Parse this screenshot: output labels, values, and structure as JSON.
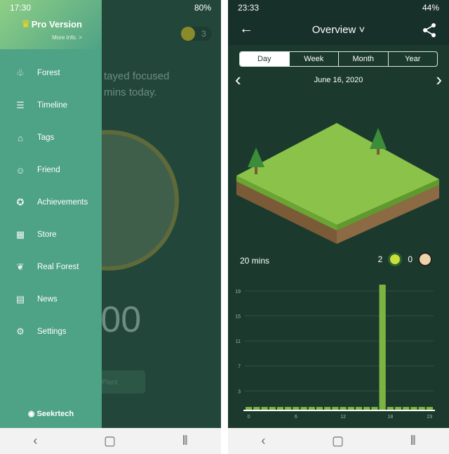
{
  "left": {
    "status": {
      "time": "17:30",
      "battery": "80%"
    },
    "drawer": {
      "pro_title": "Pro Version",
      "more_info": "More Info. >",
      "brand": "Seekrtech",
      "items": [
        {
          "label": "Forest",
          "icon": "tree-icon"
        },
        {
          "label": "Timeline",
          "icon": "timeline-icon"
        },
        {
          "label": "Tags",
          "icon": "tag-icon"
        },
        {
          "label": "Friend",
          "icon": "friend-icon"
        },
        {
          "label": "Achievements",
          "icon": "medal-icon"
        },
        {
          "label": "Store",
          "icon": "store-icon"
        },
        {
          "label": "Real Forest",
          "icon": "sprout-icon"
        },
        {
          "label": "News",
          "icon": "news-icon"
        },
        {
          "label": "Settings",
          "icon": "gear-icon"
        }
      ]
    },
    "main": {
      "coins": "3",
      "focus_line1": "tayed focused",
      "focus_line2": "mins today.",
      "timer": "0:00",
      "plant_button": "Plant"
    }
  },
  "right": {
    "status": {
      "time": "23:33",
      "battery": "44%"
    },
    "header": {
      "title": "Overview ˅"
    },
    "tabs": [
      "Day",
      "Week",
      "Month",
      "Year"
    ],
    "date": "June 16, 2020",
    "summary": {
      "total": "20 mins",
      "healthy_trees": "2",
      "dead_trees": "0"
    },
    "colors": {
      "bar": "#7cb342",
      "background": "#1b3a2d"
    }
  },
  "chart_data": {
    "type": "bar",
    "x": [
      0,
      1,
      2,
      3,
      4,
      5,
      6,
      7,
      8,
      9,
      10,
      11,
      12,
      13,
      14,
      15,
      16,
      17,
      18,
      19,
      20,
      21,
      22,
      23
    ],
    "values": [
      0,
      0,
      0,
      0,
      0,
      0,
      0,
      0,
      0,
      0,
      0,
      0,
      0,
      0,
      0,
      0,
      0,
      20,
      0,
      0,
      0,
      0,
      0,
      0
    ],
    "xticks": [
      "0",
      "6",
      "12",
      "18",
      "23"
    ],
    "yticks": [
      "3",
      "7",
      "11",
      "15",
      "19"
    ],
    "ylim": [
      0,
      20
    ],
    "grid": true
  }
}
